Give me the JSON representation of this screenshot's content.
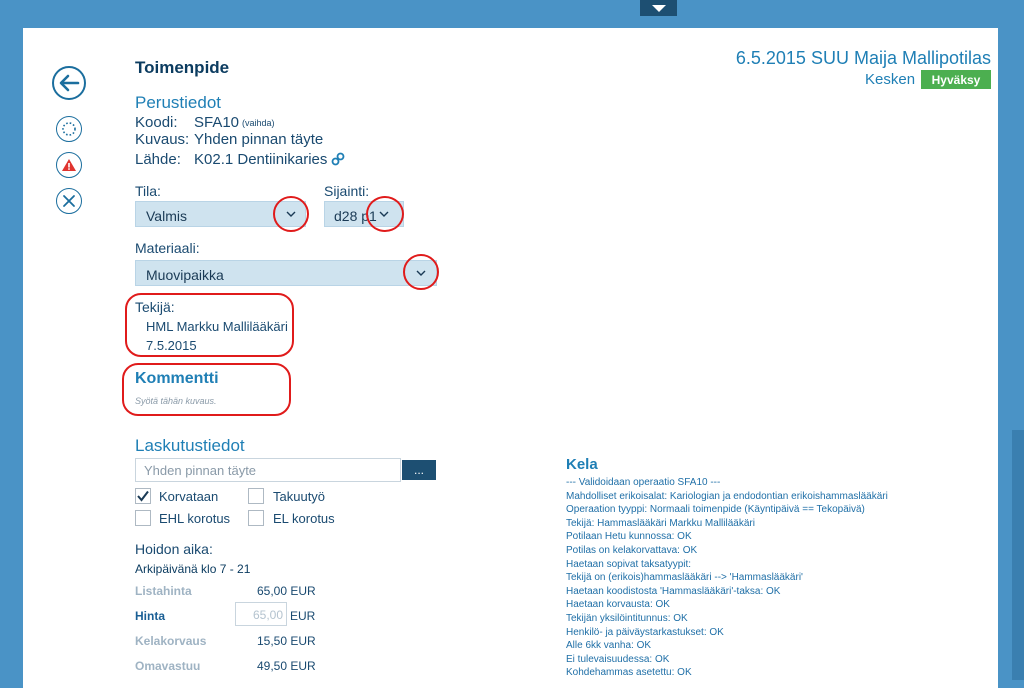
{
  "header": {
    "title": "Toimenpide",
    "patient": "6.5.2015 SUU Maija Mallipotilas",
    "status": "Kesken",
    "approve_label": "Hyväksy"
  },
  "basic": {
    "title": "Perustiedot",
    "code_label": "Koodi:",
    "code_value": "SFA10",
    "code_change": "(vaihda)",
    "desc_label": "Kuvaus:",
    "desc_value": "Yhden pinnan täyte",
    "source_label": "Lähde:",
    "source_value": "K02.1 Dentiinikaries"
  },
  "state": {
    "label": "Tila:",
    "value": "Valmis"
  },
  "location": {
    "label": "Sijainti:",
    "value": "d28 p1"
  },
  "material": {
    "label": "Materiaali:",
    "value": "Muovipaikka"
  },
  "maker": {
    "label": "Tekijä:",
    "name": "HML Markku Mallilääkäri",
    "date": "7.5.2015"
  },
  "comment": {
    "title": "Kommentti",
    "placeholder": "Syötä tähän kuvaus."
  },
  "billing": {
    "title": "Laskutustiedot",
    "input_value": "Yhden pinnan täyte",
    "more_label": "...",
    "cb_korvataan": "Korvataan",
    "cb_takuutyo": "Takuutyö",
    "cb_ehl": "EHL korotus",
    "cb_el": "EL korotus",
    "care_time_label": "Hoidon aika:",
    "care_time_value": "Arkipäivänä klo 7 - 21",
    "list_price_label": "Listahinta",
    "list_price_value": "65,00 EUR",
    "price_label": "Hinta",
    "price_input": "65,00",
    "price_unit": "EUR",
    "kela_comp_label": "Kelakorvaus",
    "kela_comp_value": "15,50 EUR",
    "own_share_label": "Omavastuu",
    "own_share_value": "49,50 EUR"
  },
  "kela": {
    "title": "Kela",
    "lines": [
      "--- Validoidaan operaatio SFA10 ---",
      "Mahdolliset erikoisalat: Kariologian ja endodontian erikoishammaslääkäri",
      "Operaation tyyppi: Normaali toimenpide (Käyntipäivä == Tekopäivä)",
      "  Tekijä: Hammaslääkäri Markku Mallilääkäri",
      "Potilaan Hetu kunnossa: OK",
      "Potilas on kelakorvattava: OK",
      "Haetaan sopivat taksatyypit:",
      "  Tekijä on (erikois)hammaslääkäri --> 'Hammaslääkäri'",
      "Haetaan koodistosta 'Hammaslääkäri'-taksa: OK",
      "Haetaan korvausta: OK",
      "Tekijän yksilöintitunnus: OK",
      "Henkilö- ja päiväystarkastukset: OK",
      "Alle 6kk vanha: OK",
      "Ei tulevaisuudessa: OK",
      "Kohdehammas asetettu: OK"
    ]
  },
  "colors": {
    "accent": "#1f7fb5",
    "approve": "#4caf50",
    "annotation": "#e01b1b"
  }
}
